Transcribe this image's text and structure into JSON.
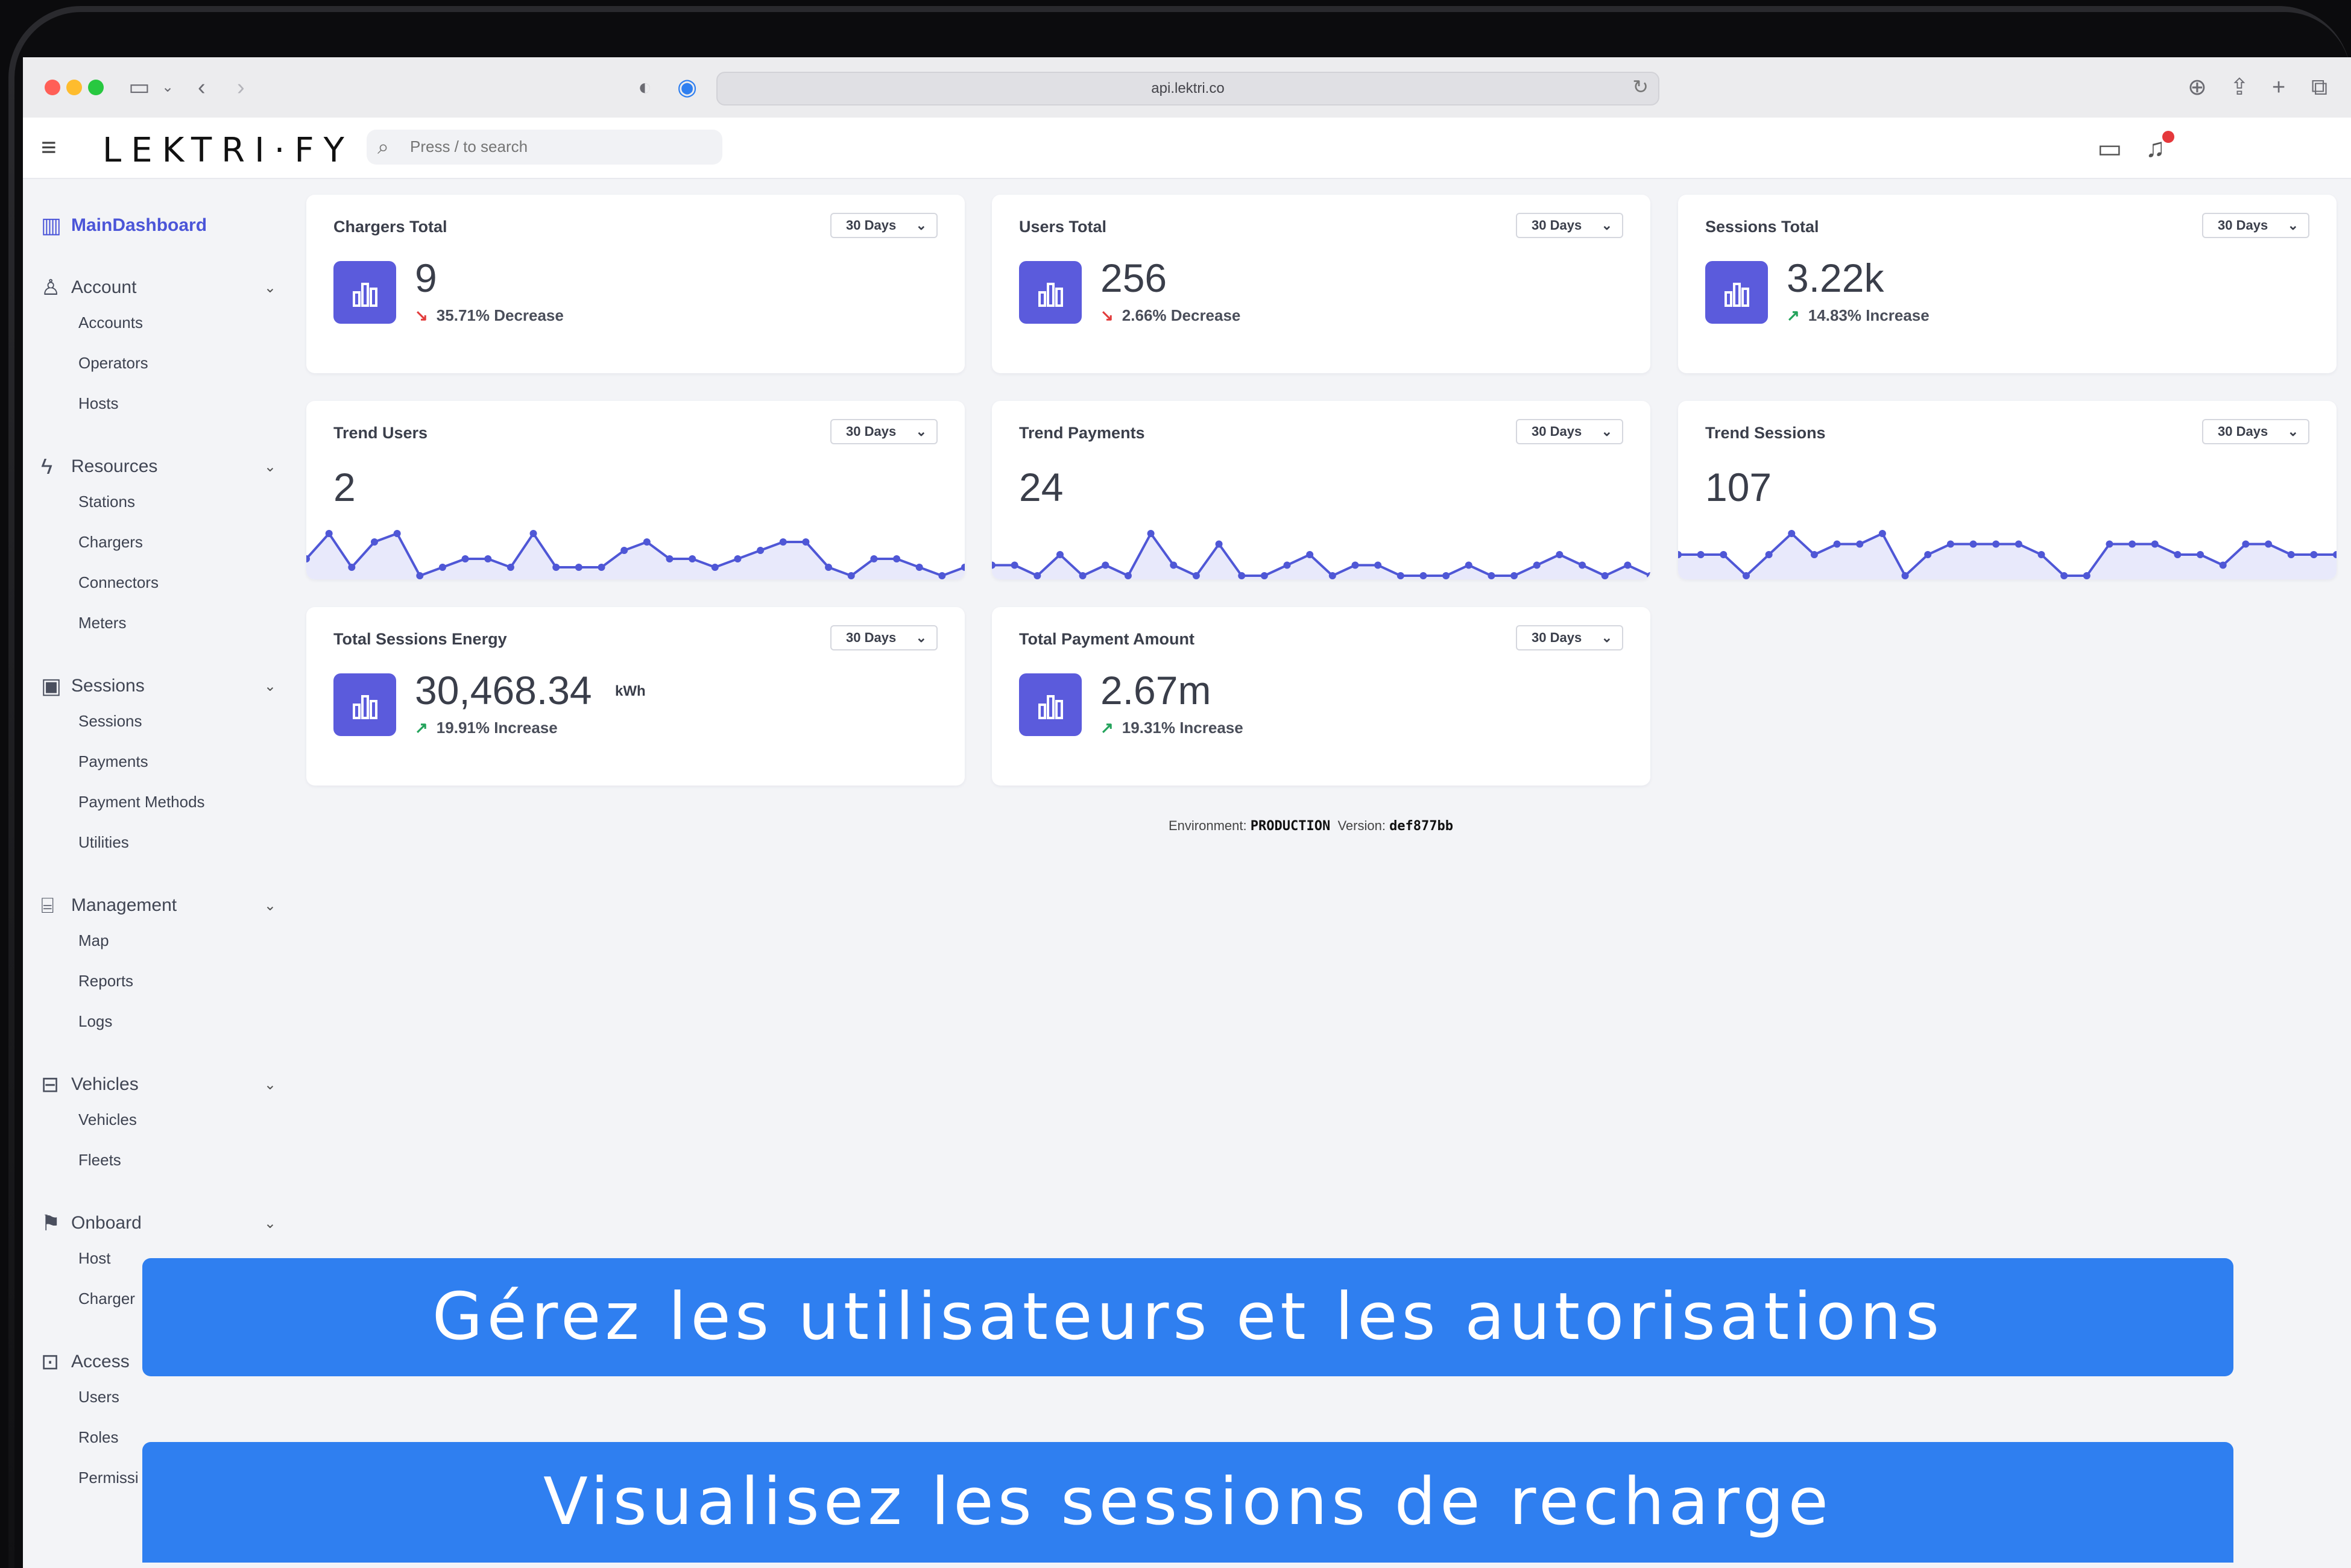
{
  "browser": {
    "url": "api.lektri.co"
  },
  "app": {
    "logo": "LEKTRI·FY",
    "search_placeholder": "Press / to search"
  },
  "sidebar": {
    "main": "MainDashboard",
    "sections": [
      {
        "title": "Account",
        "icon": "user-icon",
        "items": [
          "Accounts",
          "Operators",
          "Hosts"
        ]
      },
      {
        "title": "Resources",
        "icon": "bolt-icon",
        "items": [
          "Stations",
          "Chargers",
          "Connectors",
          "Meters"
        ]
      },
      {
        "title": "Sessions",
        "icon": "sessions-icon",
        "items": [
          "Sessions",
          "Payments",
          "Payment Methods",
          "Utilities"
        ]
      },
      {
        "title": "Management",
        "icon": "terminal-icon",
        "items": [
          "Map",
          "Reports",
          "Logs"
        ]
      },
      {
        "title": "Vehicles",
        "icon": "briefcase-icon",
        "items": [
          "Vehicles",
          "Fleets"
        ]
      },
      {
        "title": "Onboard",
        "icon": "flag-icon",
        "items": [
          "Host",
          "Charger"
        ]
      },
      {
        "title": "Access",
        "icon": "lock-icon",
        "items": [
          "Users",
          "Roles",
          "Permissi"
        ]
      }
    ]
  },
  "period_label": "30 Days",
  "stats": [
    {
      "title": "Chargers Total",
      "value": "9",
      "delta": "35.71% Decrease",
      "direction": "down"
    },
    {
      "title": "Users Total",
      "value": "256",
      "delta": "2.66% Decrease",
      "direction": "down"
    },
    {
      "title": "Sessions Total",
      "value": "3.22k",
      "delta": "14.83% Increase",
      "direction": "up"
    }
  ],
  "trends": [
    {
      "title": "Trend Users",
      "value": "2",
      "series": [
        3,
        6,
        2,
        5,
        6,
        1,
        2,
        3,
        3,
        2,
        6,
        2,
        2,
        2,
        4,
        5,
        3,
        3,
        2,
        3,
        4,
        5,
        5,
        2,
        1,
        3,
        3,
        2,
        1,
        2
      ]
    },
    {
      "title": "Trend Payments",
      "value": "24",
      "series": [
        2,
        2,
        1,
        3,
        1,
        2,
        1,
        5,
        2,
        1,
        4,
        1,
        1,
        2,
        3,
        1,
        2,
        2,
        1,
        1,
        1,
        2,
        1,
        1,
        2,
        3,
        2,
        1,
        2,
        1
      ]
    },
    {
      "title": "Trend Sessions",
      "value": "107",
      "series": [
        3,
        3,
        3,
        1,
        3,
        5,
        3,
        4,
        4,
        5,
        1,
        3,
        4,
        4,
        4,
        4,
        3,
        1,
        1,
        4,
        4,
        4,
        3,
        3,
        2,
        4,
        4,
        3,
        3,
        3
      ]
    }
  ],
  "energy": [
    {
      "title": "Total Sessions Energy",
      "value": "30,468.34",
      "unit": "kWh",
      "delta": "19.91% Increase",
      "direction": "up"
    },
    {
      "title": "Total Payment Amount",
      "value": "2.67m",
      "unit": "",
      "delta": "19.31% Increase",
      "direction": "up"
    }
  ],
  "footer": {
    "env_label": "Environment:",
    "env_value": "PRODUCTION",
    "version_label": "Version:",
    "version_value": "def877bb"
  },
  "overlays": {
    "banner1": "Gérez les utilisateurs et les autorisations",
    "banner2": "Visualisez les sessions de recharge"
  },
  "colors": {
    "accent": "#5b5bdc",
    "decrease": "#e23b3b",
    "increase": "#23a35b",
    "banner": "#2f7ff0"
  }
}
